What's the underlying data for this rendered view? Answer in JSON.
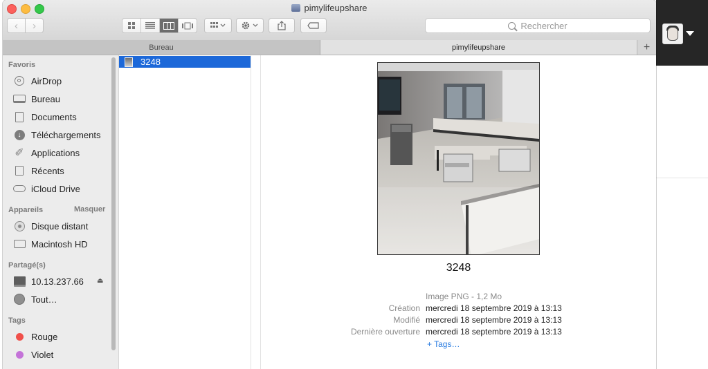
{
  "window": {
    "title": "pimylifeupshare"
  },
  "toolbar": {
    "back_icon": "chevron-left-icon",
    "forward_icon": "chevron-right-icon",
    "search_placeholder": "Rechercher"
  },
  "tabs": [
    {
      "label": "Bureau"
    },
    {
      "label": "pimylifeupshare"
    },
    {
      "label": "+"
    }
  ],
  "sidebar": {
    "favoris_header": "Favoris",
    "favoris": [
      {
        "label": "AirDrop",
        "icon": "airdrop-icon"
      },
      {
        "label": "Bureau",
        "icon": "desktop-icon"
      },
      {
        "label": "Documents",
        "icon": "documents-icon"
      },
      {
        "label": "Téléchargements",
        "icon": "downloads-icon"
      },
      {
        "label": "Applications",
        "icon": "applications-icon"
      },
      {
        "label": "Récents",
        "icon": "recents-icon"
      },
      {
        "label": "iCloud Drive",
        "icon": "cloud-icon"
      }
    ],
    "appareils_header": "Appareils",
    "masquer": "Masquer",
    "appareils": [
      {
        "label": "Disque distant",
        "icon": "remote-disc-icon"
      },
      {
        "label": "Macintosh HD",
        "icon": "hard-drive-icon"
      }
    ],
    "partage_header": "Partagé(s)",
    "partage": [
      {
        "label": "10.13.237.66",
        "icon": "monitor-icon"
      },
      {
        "label": "Tout…",
        "icon": "globe-icon"
      }
    ],
    "tags_header": "Tags",
    "tags": [
      {
        "label": "Rouge",
        "color": "#f0504a"
      },
      {
        "label": "Violet",
        "color": "#c473d8"
      }
    ]
  },
  "column": {
    "selected_item": "3248"
  },
  "preview": {
    "filename": "3248",
    "kind": "Image PNG - 1,2 Mo",
    "meta": [
      {
        "label": "Création",
        "value": "mercredi 18 septembre 2019 à 13:13"
      },
      {
        "label": "Modifié",
        "value": "mercredi 18 septembre 2019 à 13:13"
      },
      {
        "label": "Dernière ouverture",
        "value": "mercredi 18 septembre 2019 à 13:13"
      }
    ],
    "tags_link": "+ Tags…"
  }
}
